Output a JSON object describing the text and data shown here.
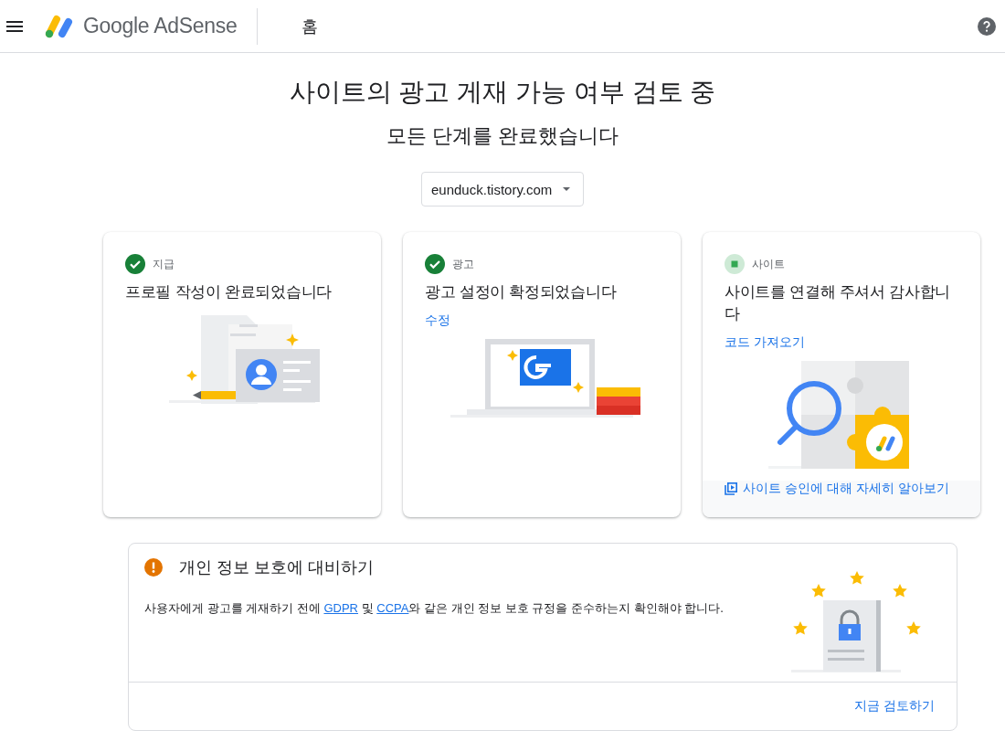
{
  "header": {
    "brand": "Google AdSense",
    "page": "홈"
  },
  "title": "사이트의 광고 게재 가능 여부 검토 중",
  "subtitle": "모든 단계를 완료했습니다",
  "site_select": {
    "value": "eunduck.tistory.com"
  },
  "cards": [
    {
      "kind": "profile",
      "complete": true,
      "step": "지급",
      "heading": "프로필 작성이 완료되었습니다"
    },
    {
      "kind": "ads",
      "complete": true,
      "step": "광고",
      "heading": "광고 설정이 확정되었습니다",
      "link": "수정"
    },
    {
      "kind": "site",
      "complete": false,
      "step": "사이트",
      "heading": "사이트를 연결해 주셔서 감사합니다",
      "link": "코드 가져오기",
      "footer_link": "사이트 승인에 대해 자세히 알아보기"
    }
  ],
  "privacy": {
    "heading": "개인 정보 보호에 대비하기",
    "body": [
      {
        "kind": "text",
        "text": "사용자에게 광고를 게재하기 전에 "
      },
      {
        "kind": "link",
        "text": "GDPR"
      },
      {
        "kind": "text",
        "text": " 및 "
      },
      {
        "kind": "link",
        "text": "CCPA"
      },
      {
        "kind": "text",
        "text": "와 같은 개인 정보 보호 규정을 준수하는지 확인해야 합니다."
      }
    ],
    "action": "지금 검토하기"
  }
}
